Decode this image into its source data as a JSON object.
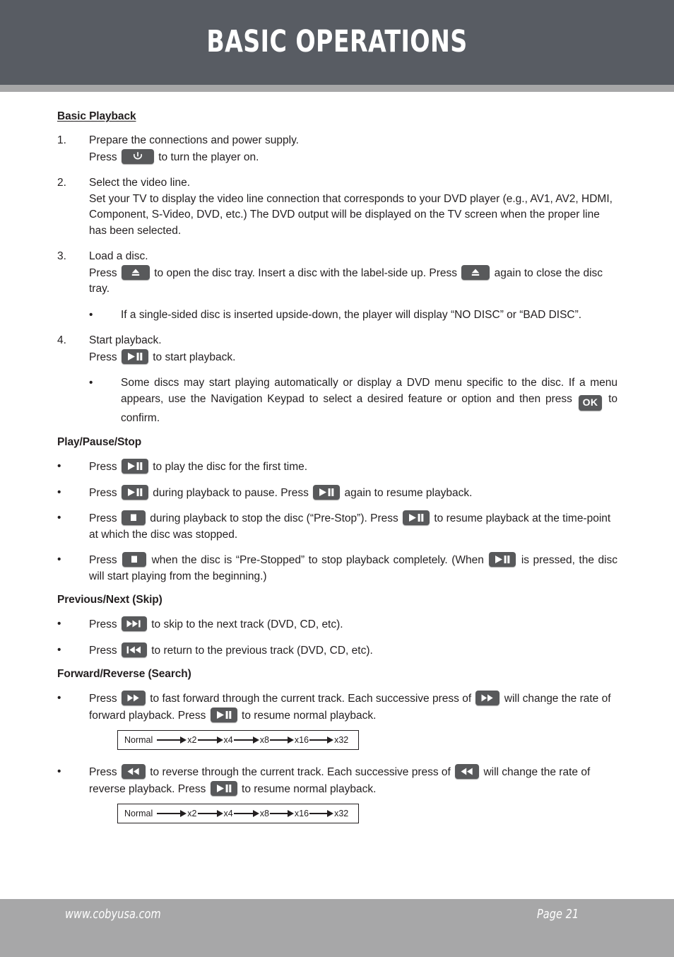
{
  "page": {
    "header_title": "BASIC OPERATIONS",
    "colors": {
      "header_band": "#585c63",
      "header_rule": "#a7a7a8",
      "footer_band": "#a7a7a8",
      "button_face": "#58595b",
      "text": "#231f20"
    }
  },
  "sections": {
    "basic_playback": {
      "heading": "Basic Playback",
      "steps": [
        {
          "number": "1.",
          "line1": "Prepare the connections and power supply.",
          "line2_pre": "Press",
          "line2_icon": "power-button",
          "line2_post": "to turn the player on."
        },
        {
          "number": "2.",
          "line1": "Select the video line.",
          "line2": "Set your TV to display the video line connection that corresponds to your DVD player (e.g., AV1, AV2, HDMI, Component, S-Video, DVD, etc.) The DVD output will be displayed on the TV screen when the proper line has been selected."
        },
        {
          "number": "3.",
          "line1": "Load a disc.",
          "line2_pre": "Press",
          "line2_icon": "eject-button",
          "line2_mid": "to open the disc tray. Insert a disc with the label-side up. Press",
          "line2_icon2": "eject-button",
          "line2_post": "again to close the disc tray."
        },
        {
          "number": "4.",
          "line1": "Start playback.",
          "line2_pre": "Press",
          "line2_icon": "play-pause-button",
          "line2_post": "to start playback."
        }
      ],
      "bullet_after_step3": {
        "marker": "•",
        "text": "If a single-sided disc is inserted upside-down, the player will display “NO DISC” or “BAD DISC”."
      },
      "bullet_after_step4": {
        "marker": "•",
        "text_pre": "Some discs may start playing automatically or display a DVD menu specific to the disc. If a menu appears, use the Navigation Keypad to select a desired feature or option and then press",
        "icon": "ok-button",
        "icon_label": "OK",
        "text_post": "to confirm."
      }
    },
    "play_pause_stop": {
      "heading": "Play/Pause/Stop",
      "bullets": [
        {
          "marker": "•",
          "pre": "Press",
          "icon1": "play-pause-button",
          "mid": "to play the disc for the first time.",
          "icon2": "",
          "post": ""
        },
        {
          "marker": "•",
          "pre": "Press",
          "icon1": "play-pause-button",
          "mid": "during playback to pause. Press",
          "icon2": "play-pause-button",
          "post": "again to resume playback."
        },
        {
          "marker": "•",
          "pre": "Press",
          "icon1": "stop-button",
          "mid": "during playback to stop the disc (“Pre-Stop”). Press",
          "icon2": "play-pause-button",
          "post": "to resume playback at the time-point at which the disc was stopped."
        },
        {
          "marker": "•",
          "pre": "Press",
          "icon1": "stop-button",
          "mid": "when the disc is “Pre-Stopped” to stop playback completely. (When",
          "icon2": "play-pause-button",
          "post": "is pressed, the disc will start playing from the beginning.)"
        }
      ]
    },
    "previous_next": {
      "heading": "Previous/Next (Skip)",
      "bullets": [
        {
          "marker": "•",
          "pre": "Press",
          "icon1": "skip-next-button",
          "post": "to skip to the next track (DVD, CD, etc)."
        },
        {
          "marker": "•",
          "pre": "Press",
          "icon1": "skip-previous-button",
          "post": "to return to the previous track (DVD, CD, etc)."
        }
      ]
    },
    "forward_reverse": {
      "heading": "Forward/Reverse (Search)",
      "bullets": [
        {
          "marker": "•",
          "pre": "Press",
          "icon1": "fast-forward-button",
          "mid": "to fast forward through the current track. Each successive press of",
          "icon2": "fast-forward-button",
          "mid2": "will change the rate of forward playback. Press",
          "icon3": "play-pause-button",
          "post": "to resume normal playback."
        },
        {
          "marker": "•",
          "pre": "Press",
          "icon1": "rewind-button",
          "mid": "to reverse through the current track. Each successive press of",
          "icon2": "rewind-button",
          "mid2": "will change the rate of reverse playback. Press",
          "icon3": "play-pause-button",
          "post": "to resume normal playback."
        }
      ],
      "rate_diagram_forward": {
        "start_label": "Normal",
        "rates": [
          "x2",
          "x4",
          "x8",
          "x16",
          "x32"
        ]
      },
      "rate_diagram_reverse": {
        "start_label": "Normal",
        "rates": [
          "x2",
          "x4",
          "x8",
          "x16",
          "x32"
        ]
      }
    }
  },
  "footer": {
    "website": "www.cobyusa.com",
    "page_number": "Page 21"
  }
}
